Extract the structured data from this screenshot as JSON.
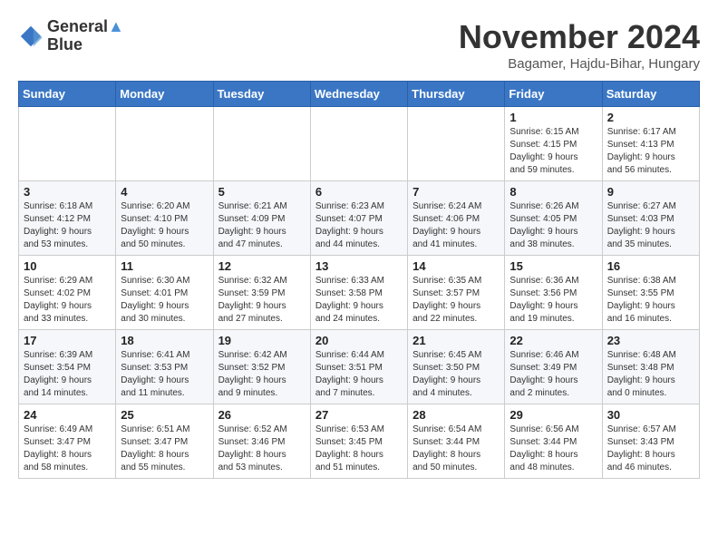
{
  "header": {
    "logo_line1": "General",
    "logo_line2": "Blue",
    "month": "November 2024",
    "location": "Bagamer, Hajdu-Bihar, Hungary"
  },
  "days_of_week": [
    "Sunday",
    "Monday",
    "Tuesday",
    "Wednesday",
    "Thursday",
    "Friday",
    "Saturday"
  ],
  "weeks": [
    [
      {
        "day": "",
        "info": ""
      },
      {
        "day": "",
        "info": ""
      },
      {
        "day": "",
        "info": ""
      },
      {
        "day": "",
        "info": ""
      },
      {
        "day": "",
        "info": ""
      },
      {
        "day": "1",
        "info": "Sunrise: 6:15 AM\nSunset: 4:15 PM\nDaylight: 9 hours\nand 59 minutes."
      },
      {
        "day": "2",
        "info": "Sunrise: 6:17 AM\nSunset: 4:13 PM\nDaylight: 9 hours\nand 56 minutes."
      }
    ],
    [
      {
        "day": "3",
        "info": "Sunrise: 6:18 AM\nSunset: 4:12 PM\nDaylight: 9 hours\nand 53 minutes."
      },
      {
        "day": "4",
        "info": "Sunrise: 6:20 AM\nSunset: 4:10 PM\nDaylight: 9 hours\nand 50 minutes."
      },
      {
        "day": "5",
        "info": "Sunrise: 6:21 AM\nSunset: 4:09 PM\nDaylight: 9 hours\nand 47 minutes."
      },
      {
        "day": "6",
        "info": "Sunrise: 6:23 AM\nSunset: 4:07 PM\nDaylight: 9 hours\nand 44 minutes."
      },
      {
        "day": "7",
        "info": "Sunrise: 6:24 AM\nSunset: 4:06 PM\nDaylight: 9 hours\nand 41 minutes."
      },
      {
        "day": "8",
        "info": "Sunrise: 6:26 AM\nSunset: 4:05 PM\nDaylight: 9 hours\nand 38 minutes."
      },
      {
        "day": "9",
        "info": "Sunrise: 6:27 AM\nSunset: 4:03 PM\nDaylight: 9 hours\nand 35 minutes."
      }
    ],
    [
      {
        "day": "10",
        "info": "Sunrise: 6:29 AM\nSunset: 4:02 PM\nDaylight: 9 hours\nand 33 minutes."
      },
      {
        "day": "11",
        "info": "Sunrise: 6:30 AM\nSunset: 4:01 PM\nDaylight: 9 hours\nand 30 minutes."
      },
      {
        "day": "12",
        "info": "Sunrise: 6:32 AM\nSunset: 3:59 PM\nDaylight: 9 hours\nand 27 minutes."
      },
      {
        "day": "13",
        "info": "Sunrise: 6:33 AM\nSunset: 3:58 PM\nDaylight: 9 hours\nand 24 minutes."
      },
      {
        "day": "14",
        "info": "Sunrise: 6:35 AM\nSunset: 3:57 PM\nDaylight: 9 hours\nand 22 minutes."
      },
      {
        "day": "15",
        "info": "Sunrise: 6:36 AM\nSunset: 3:56 PM\nDaylight: 9 hours\nand 19 minutes."
      },
      {
        "day": "16",
        "info": "Sunrise: 6:38 AM\nSunset: 3:55 PM\nDaylight: 9 hours\nand 16 minutes."
      }
    ],
    [
      {
        "day": "17",
        "info": "Sunrise: 6:39 AM\nSunset: 3:54 PM\nDaylight: 9 hours\nand 14 minutes."
      },
      {
        "day": "18",
        "info": "Sunrise: 6:41 AM\nSunset: 3:53 PM\nDaylight: 9 hours\nand 11 minutes."
      },
      {
        "day": "19",
        "info": "Sunrise: 6:42 AM\nSunset: 3:52 PM\nDaylight: 9 hours\nand 9 minutes."
      },
      {
        "day": "20",
        "info": "Sunrise: 6:44 AM\nSunset: 3:51 PM\nDaylight: 9 hours\nand 7 minutes."
      },
      {
        "day": "21",
        "info": "Sunrise: 6:45 AM\nSunset: 3:50 PM\nDaylight: 9 hours\nand 4 minutes."
      },
      {
        "day": "22",
        "info": "Sunrise: 6:46 AM\nSunset: 3:49 PM\nDaylight: 9 hours\nand 2 minutes."
      },
      {
        "day": "23",
        "info": "Sunrise: 6:48 AM\nSunset: 3:48 PM\nDaylight: 9 hours\nand 0 minutes."
      }
    ],
    [
      {
        "day": "24",
        "info": "Sunrise: 6:49 AM\nSunset: 3:47 PM\nDaylight: 8 hours\nand 58 minutes."
      },
      {
        "day": "25",
        "info": "Sunrise: 6:51 AM\nSunset: 3:47 PM\nDaylight: 8 hours\nand 55 minutes."
      },
      {
        "day": "26",
        "info": "Sunrise: 6:52 AM\nSunset: 3:46 PM\nDaylight: 8 hours\nand 53 minutes."
      },
      {
        "day": "27",
        "info": "Sunrise: 6:53 AM\nSunset: 3:45 PM\nDaylight: 8 hours\nand 51 minutes."
      },
      {
        "day": "28",
        "info": "Sunrise: 6:54 AM\nSunset: 3:44 PM\nDaylight: 8 hours\nand 50 minutes."
      },
      {
        "day": "29",
        "info": "Sunrise: 6:56 AM\nSunset: 3:44 PM\nDaylight: 8 hours\nand 48 minutes."
      },
      {
        "day": "30",
        "info": "Sunrise: 6:57 AM\nSunset: 3:43 PM\nDaylight: 8 hours\nand 46 minutes."
      }
    ]
  ]
}
